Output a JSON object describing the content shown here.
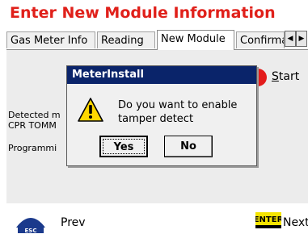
{
  "header": {
    "title": "Enter New Module Information"
  },
  "tabs": [
    {
      "label": "Gas Meter Info"
    },
    {
      "label": "Reading"
    },
    {
      "label": "New Module"
    },
    {
      "label": "Confirma"
    }
  ],
  "panel": {
    "start_label_rest": "tart",
    "start_label_underlined": "S",
    "background_lines": [
      "Detected m",
      "CPR TOMM",
      "Programmi"
    ]
  },
  "dialog": {
    "title": "MeterInstall",
    "message_line1": "Do you want to enable",
    "message_line2": "tamper detect",
    "yes_label": "Yes",
    "no_label": "No",
    "icon": "warning-icon"
  },
  "footer": {
    "prev_label": "Prev",
    "next_label": "Next",
    "esc_icon_text": "ESC",
    "enter_icon_text": "ENTER"
  },
  "colors": {
    "title_red": "#e0201a",
    "dialog_title_bg": "#0a246a",
    "start_red": "#e31b1b",
    "esc_blue": "#1b3a8c",
    "enter_yellow": "#f5e400"
  }
}
